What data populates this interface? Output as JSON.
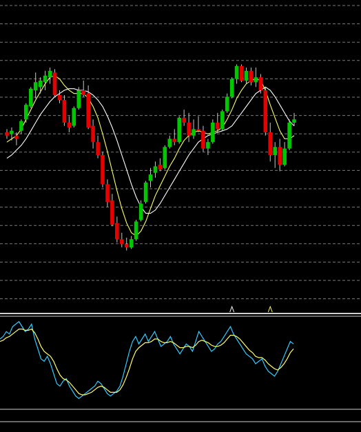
{
  "chart_data": [
    {
      "type": "candlestick",
      "panel": "price",
      "title": "",
      "grid": true,
      "colors": {
        "background": "#000000",
        "up": "#00c800",
        "down": "#e60000",
        "wick": "#c8c8c8",
        "ma_fast": "#ffff66",
        "ma_slow": "#ffffff",
        "grid": "#9a9a9a"
      },
      "ylim": [
        0,
        100
      ],
      "candles": [
        {
          "o": 54,
          "h": 56,
          "l": 50,
          "c": 52
        },
        {
          "o": 53,
          "h": 57,
          "l": 49,
          "c": 55
        },
        {
          "o": 52,
          "h": 54,
          "l": 46,
          "c": 50
        },
        {
          "o": 55,
          "h": 62,
          "l": 53,
          "c": 61
        },
        {
          "o": 62,
          "h": 72,
          "l": 60,
          "c": 71
        },
        {
          "o": 70,
          "h": 82,
          "l": 69,
          "c": 81
        },
        {
          "o": 80,
          "h": 91,
          "l": 75,
          "c": 85
        },
        {
          "o": 82,
          "h": 88,
          "l": 78,
          "c": 86
        },
        {
          "o": 85,
          "h": 92,
          "l": 80,
          "c": 89
        },
        {
          "o": 88,
          "h": 94,
          "l": 84,
          "c": 92
        },
        {
          "o": 91,
          "h": 93,
          "l": 76,
          "c": 77
        },
        {
          "o": 77,
          "h": 80,
          "l": 72,
          "c": 74
        },
        {
          "o": 74,
          "h": 77,
          "l": 58,
          "c": 60
        },
        {
          "o": 60,
          "h": 64,
          "l": 54,
          "c": 57
        },
        {
          "o": 58,
          "h": 70,
          "l": 57,
          "c": 69
        },
        {
          "o": 69,
          "h": 82,
          "l": 68,
          "c": 80
        },
        {
          "o": 80,
          "h": 86,
          "l": 76,
          "c": 77
        },
        {
          "o": 78,
          "h": 83,
          "l": 56,
          "c": 57
        },
        {
          "o": 58,
          "h": 62,
          "l": 44,
          "c": 48
        },
        {
          "o": 48,
          "h": 52,
          "l": 38,
          "c": 40
        },
        {
          "o": 40,
          "h": 42,
          "l": 20,
          "c": 22
        },
        {
          "o": 22,
          "h": 25,
          "l": 8,
          "c": 11
        },
        {
          "o": 12,
          "h": 16,
          "l": -4,
          "c": -3
        },
        {
          "o": -2,
          "h": 2,
          "l": -14,
          "c": -12
        },
        {
          "o": -12,
          "h": -8,
          "l": -17,
          "c": -15
        },
        {
          "o": -15,
          "h": -11,
          "l": -19,
          "c": -17
        },
        {
          "o": -17,
          "h": -10,
          "l": -18,
          "c": -12
        },
        {
          "o": -12,
          "h": 0,
          "l": -13,
          "c": -1
        },
        {
          "o": 0,
          "h": 12,
          "l": -1,
          "c": 10
        },
        {
          "o": 11,
          "h": 24,
          "l": 10,
          "c": 23
        },
        {
          "o": 24,
          "h": 32,
          "l": 20,
          "c": 28
        },
        {
          "o": 29,
          "h": 36,
          "l": 26,
          "c": 33
        },
        {
          "o": 34,
          "h": 38,
          "l": 30,
          "c": 31
        },
        {
          "o": 32,
          "h": 46,
          "l": 31,
          "c": 45
        },
        {
          "o": 45,
          "h": 52,
          "l": 44,
          "c": 50
        },
        {
          "o": 50,
          "h": 56,
          "l": 46,
          "c": 48
        },
        {
          "o": 48,
          "h": 64,
          "l": 47,
          "c": 63
        },
        {
          "o": 63,
          "h": 68,
          "l": 58,
          "c": 60
        },
        {
          "o": 60,
          "h": 66,
          "l": 48,
          "c": 52
        },
        {
          "o": 52,
          "h": 62,
          "l": 50,
          "c": 56
        },
        {
          "o": 56,
          "h": 64,
          "l": 54,
          "c": 55
        },
        {
          "o": 55,
          "h": 58,
          "l": 42,
          "c": 44
        },
        {
          "o": 44,
          "h": 50,
          "l": 40,
          "c": 48
        },
        {
          "o": 48,
          "h": 62,
          "l": 47,
          "c": 60
        },
        {
          "o": 60,
          "h": 66,
          "l": 54,
          "c": 56
        },
        {
          "o": 56,
          "h": 68,
          "l": 55,
          "c": 67
        },
        {
          "o": 67,
          "h": 78,
          "l": 66,
          "c": 76
        },
        {
          "o": 76,
          "h": 88,
          "l": 75,
          "c": 87
        },
        {
          "o": 87,
          "h": 96,
          "l": 84,
          "c": 95
        },
        {
          "o": 95,
          "h": 96,
          "l": 85,
          "c": 86
        },
        {
          "o": 86,
          "h": 94,
          "l": 84,
          "c": 92
        },
        {
          "o": 92,
          "h": 94,
          "l": 83,
          "c": 85
        },
        {
          "o": 85,
          "h": 94,
          "l": 82,
          "c": 88
        },
        {
          "o": 88,
          "h": 90,
          "l": 78,
          "c": 80
        },
        {
          "o": 80,
          "h": 82,
          "l": 52,
          "c": 54
        },
        {
          "o": 54,
          "h": 60,
          "l": 36,
          "c": 40
        },
        {
          "o": 40,
          "h": 48,
          "l": 32,
          "c": 45
        },
        {
          "o": 45,
          "h": 50,
          "l": 30,
          "c": 34
        },
        {
          "o": 34,
          "h": 48,
          "l": 33,
          "c": 44
        },
        {
          "o": 44,
          "h": 62,
          "l": 43,
          "c": 60
        },
        {
          "o": 60,
          "h": 66,
          "l": 58,
          "c": 62
        }
      ],
      "series": [
        {
          "values": [
            48,
            50,
            52,
            56,
            62,
            68,
            74,
            79,
            84,
            88,
            89,
            87,
            83,
            80,
            78,
            78,
            78,
            75,
            70,
            63,
            53,
            42,
            30,
            18,
            7,
            -2,
            -8,
            -10,
            -7,
            -1,
            7,
            15,
            21,
            27,
            33,
            38,
            44,
            49,
            52,
            54,
            55,
            54,
            53,
            54,
            55,
            57,
            62,
            68,
            75,
            80,
            84,
            86,
            87,
            86,
            80,
            71,
            63,
            55,
            50,
            50,
            52
          ]
        },
        {
          "values": [
            38,
            40,
            43,
            46,
            50,
            55,
            60,
            65,
            69,
            73,
            76,
            78,
            80,
            81,
            81,
            80,
            80,
            79,
            77,
            74,
            70,
            64,
            57,
            49,
            40,
            31,
            22,
            14,
            8,
            4,
            4,
            6,
            10,
            15,
            20,
            25,
            30,
            35,
            40,
            44,
            48,
            50,
            52,
            53,
            54,
            55,
            56,
            58,
            62,
            66,
            70,
            74,
            78,
            80,
            82,
            80,
            76,
            71,
            66,
            61,
            58
          ]
        }
      ],
      "markers": [
        {
          "index": 47,
          "symbol": "up"
        },
        {
          "index": 55,
          "symbol": "up"
        }
      ]
    },
    {
      "type": "line",
      "panel": "oscillator",
      "title": "",
      "grid": false,
      "ylim": [
        0,
        100
      ],
      "series": [
        {
          "color": "#33ccff",
          "values": [
            60,
            62,
            66,
            64,
            70,
            72,
            74,
            70,
            66,
            68,
            72,
            60,
            52,
            44,
            42,
            46,
            40,
            32,
            24,
            22,
            26,
            28,
            22,
            18,
            14,
            12,
            14,
            16,
            18,
            20,
            22,
            26,
            24,
            20,
            16,
            14,
            16,
            18,
            22,
            30,
            40,
            50,
            58,
            62,
            56,
            60,
            64,
            58,
            62,
            66,
            60,
            54,
            56,
            58,
            62,
            56,
            52,
            48,
            52,
            56,
            54,
            50,
            58,
            66,
            62,
            58,
            54,
            50,
            52,
            56,
            58,
            62,
            66,
            70,
            64,
            60,
            56,
            52,
            48,
            46,
            44,
            40,
            42,
            44,
            38,
            34,
            32,
            30,
            34,
            40,
            46,
            52,
            58,
            56
          ]
        },
        {
          "color": "#ffff66",
          "values": [
            58,
            59,
            61,
            62,
            64,
            66,
            68,
            68,
            67,
            67,
            68,
            65,
            60,
            54,
            50,
            48,
            46,
            42,
            36,
            31,
            28,
            27,
            25,
            22,
            19,
            16,
            15,
            15,
            16,
            17,
            19,
            21,
            22,
            21,
            19,
            17,
            17,
            17,
            19,
            23,
            29,
            36,
            44,
            50,
            53,
            55,
            57,
            57,
            58,
            60,
            60,
            58,
            57,
            57,
            58,
            57,
            55,
            53,
            53,
            54,
            54,
            53,
            55,
            58,
            59,
            58,
            57,
            55,
            54,
            54,
            55,
            57,
            60,
            63,
            63,
            62,
            60,
            57,
            54,
            51,
            49,
            46,
            45,
            45,
            43,
            40,
            38,
            36,
            35,
            37,
            40,
            44,
            49,
            52
          ]
        }
      ]
    }
  ]
}
